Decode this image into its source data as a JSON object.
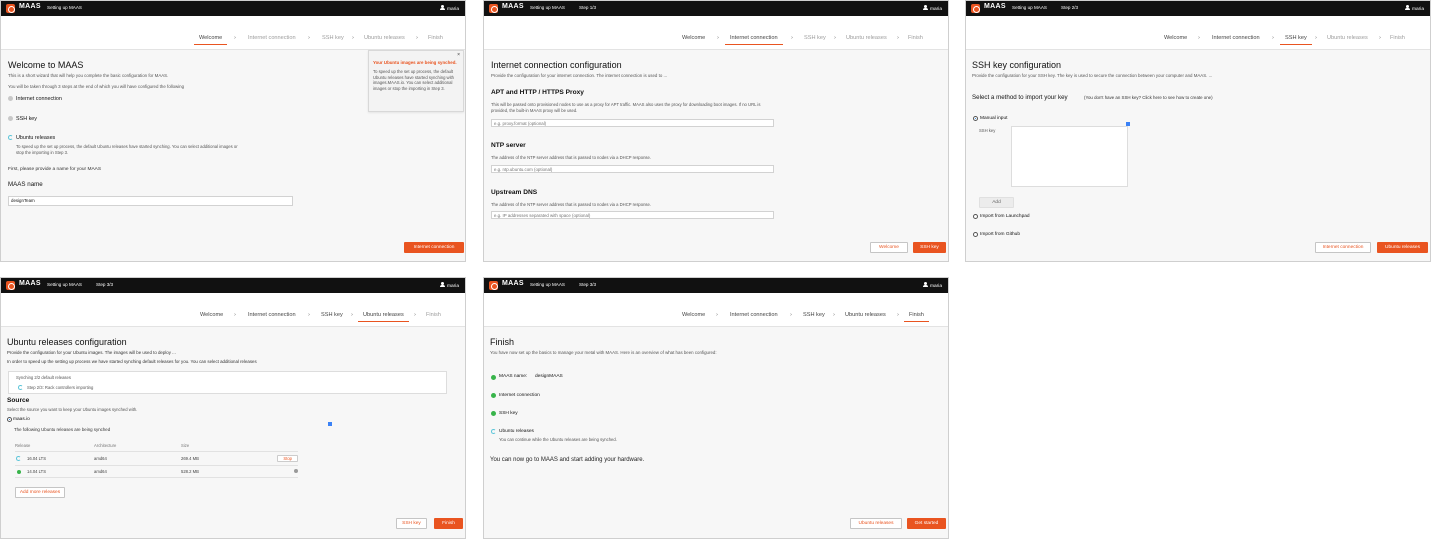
{
  "topbar": {
    "brand": "MAAS",
    "setup_link": "Setting up MAAS",
    "user": "maria",
    "steps": [
      "Step 1/3",
      "Step 2/3",
      "Step 3/3"
    ]
  },
  "stepper": {
    "welcome": "Welcome",
    "internet": "Internet connection",
    "ssh": "SSH key",
    "ubuntu": "Ubuntu releases",
    "finish": "Finish"
  },
  "welcome": {
    "title": "Welcome to MAAS",
    "intro1": "This is a short wizard that will help you complete the basic configuration for MAAS.",
    "intro2": "You will be taken through 3 steps at the end of which you will have configured the following",
    "items": [
      "Internet connection",
      "SSH key",
      "Ubuntu releases"
    ],
    "ubuntu_note": "To speed up the set up process, the default Ubuntu releases have started synching. You can select additional images or stop the importing in Step 3.",
    "name_intro": "First, please provide a name for your MAAS",
    "name_label": "MAAS name",
    "name_value": "designTeam",
    "next_button": "Internet connection",
    "notice_title": "Your Ubuntu images are being synched.",
    "notice_text": "To speed up the set up process, the default Ubuntu releases have started synching with images.MAAS.io. You can select additional images or stop the importing in Step 3."
  },
  "internet": {
    "title": "Internet connection configuration",
    "intro": "Provide the configuration for your internet connection. The internet connection is used to ...",
    "proxy_title": "APT and HTTP / HTTPS Proxy",
    "proxy_desc": "This will be passed onto provisioned nodes to use as a proxy for APT traffic. MAAS also uses the proxy for downloading boot images. If no URL is provided, the built-in MAAS proxy will be used.",
    "proxy_placeholder": "e.g. proxy.format (optional)",
    "ntp_title": "NTP server",
    "ntp_desc": "The address of the NTP server address that is passed to nodes via a DHCP response.",
    "ntp_placeholder": "e.g. ntp.ubuntu.com (optional)",
    "dns_title": "Upstream DNS",
    "dns_desc": "The address of the NTP server address that is passed to nodes via a DHCP response.",
    "dns_placeholder": "e.g. IP addresses separated with space (optional)",
    "back_button": "Welcome",
    "next_button": "SSH key"
  },
  "ssh": {
    "title": "SSH key configuration",
    "intro": "Provide the configuration for your SSH key. The key is used to secure the connection between your computer and MAAS. ...",
    "method_title": "Select a method to import your key",
    "method_hint": "(You don't have an SSH key? Click  here  to see how to create one)",
    "manual": "Manual input",
    "ssh_key_label": "SSH key",
    "add_button": "Add",
    "launchpad": "Import from Launchpad",
    "github": "Import from Github",
    "back_button": "Internet connection",
    "next_button": "Ubuntu releases"
  },
  "ubuntu": {
    "title": "Ubuntu releases configuration",
    "intro1": "Provide the configuration for your Ubuntu images. The images will be used to deploy ...",
    "intro2": "In order to speed up the setting up process we have started synching default releases for you. You can select additional releases",
    "sync_title": "Synching 2/2 default releases",
    "sync_step": "Step 2/3: Rack controllers importing",
    "source_title": "Source",
    "source_desc": "Select the source you want to keep your Ubuntu images synched with.",
    "source_value": "maas.io",
    "synching_heading": "The following Ubuntu releases are being synched",
    "table_headers": [
      "Release",
      "Architecture",
      "Size"
    ],
    "rows": [
      {
        "release": "16.04 LTS",
        "arch": "amd64",
        "size": "269.4 MB",
        "action": "Stop"
      },
      {
        "release": "14.04 LTS",
        "arch": "amd64",
        "size": "528.2 MB",
        "action": ""
      }
    ],
    "add_more": "Add more releases",
    "back_button": "SSH key",
    "next_button": "Finish"
  },
  "finish": {
    "title": "Finish",
    "intro": "You have now set up the basics to manage your metal with MAAS. Here is an overview of what has been configured:",
    "name_label": "MAAS name:",
    "name_value": "designMAAS",
    "items": [
      "Internet connection",
      "SSH key",
      "Ubuntu releases"
    ],
    "ubuntu_note": "You can continue while the Ubuntu releases are being synched.",
    "closing": "You can now go to MAAS and start adding your hardware.",
    "back_button": "Ubuntu releases",
    "next_button": "Get started"
  },
  "colors": {
    "accent": "#e95420",
    "success": "#38b44a",
    "info": "#59c4d8",
    "topbar": "#111111"
  }
}
